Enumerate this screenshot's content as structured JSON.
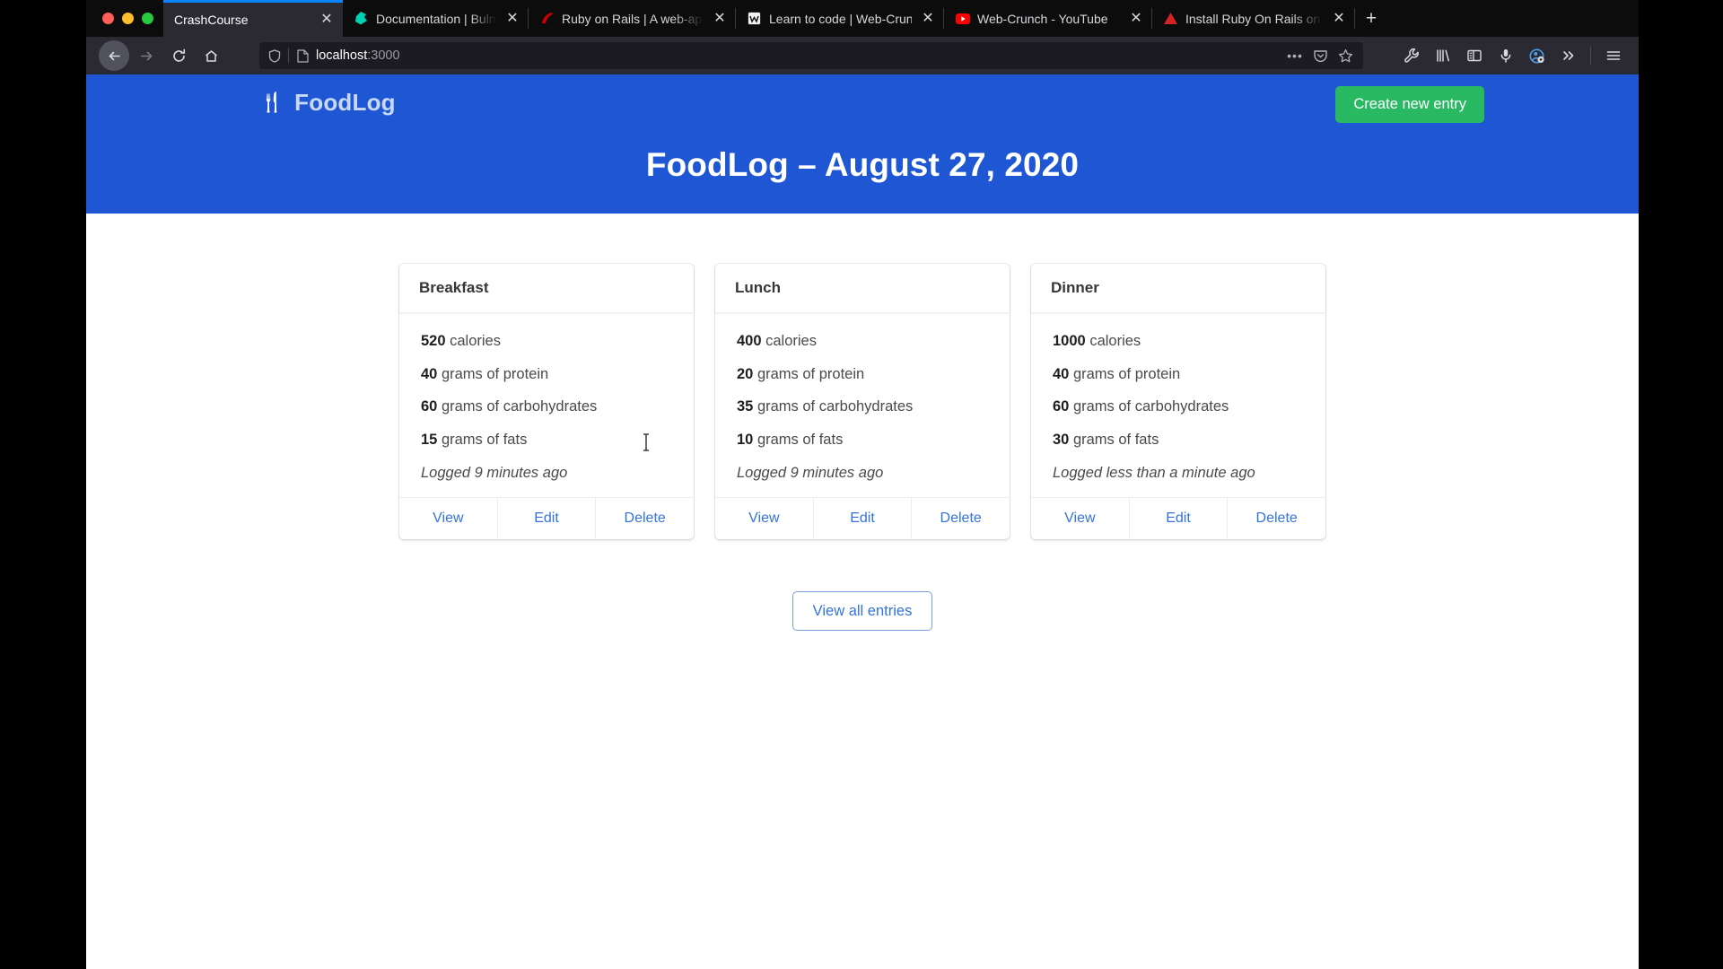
{
  "browser": {
    "traffic_lights": [
      "close",
      "minimize",
      "maximize"
    ],
    "tabs": [
      {
        "title": "CrashCourse",
        "favicon": "",
        "active": true,
        "close_label": "✕"
      },
      {
        "title": "Documentation | Bulma: Free, o",
        "favicon": "bulma-icon",
        "active": false,
        "close_label": "✕"
      },
      {
        "title": "Ruby on Rails | A web-applicat",
        "favicon": "rails-icon",
        "active": false,
        "close_label": "✕"
      },
      {
        "title": "Learn to code | Web-Crunch",
        "favicon": "webcrunch-icon",
        "active": false,
        "close_label": "✕"
      },
      {
        "title": "Web-Crunch - YouTube",
        "favicon": "youtube-icon",
        "active": false,
        "close_label": "✕"
      },
      {
        "title": "Install Ruby On Rails on macOS",
        "favicon": "medium-icon",
        "active": false,
        "close_label": "✕"
      }
    ],
    "new_tab_label": "+",
    "nav": {
      "back_label": "←",
      "forward_label": "→",
      "reload_label": "↻",
      "home_label": "⌂"
    },
    "url_bar": {
      "host": "localhost",
      "port": ":3000",
      "shield_icon": "shield-icon",
      "page_icon": "page-icon",
      "more_icon": "•••",
      "pocket_icon": "pocket-icon",
      "bookmark_icon": "star-icon"
    },
    "toolbar_icons": [
      "wrench-icon",
      "library-icon",
      "sidebar-icon",
      "pocket-save-icon",
      "container-account-icon",
      "overflow-chevrons-icon",
      "hamburger-menu-icon"
    ]
  },
  "page": {
    "brand": {
      "icon": "🍴",
      "name": "FoodLog"
    },
    "create_entry_label": "Create new entry",
    "title": "FoodLog – August 27, 2020",
    "view_all_label": "View all entries",
    "cards": [
      {
        "name": "Breakfast",
        "calories_value": "520",
        "calories_label": "calories",
        "protein_value": "40",
        "protein_label": "grams of protein",
        "carbs_value": "60",
        "carbs_label": "grams of carbohydrates",
        "fats_value": "15",
        "fats_label": "grams of fats",
        "logged": "Logged 9 minutes ago",
        "actions": {
          "view": "View",
          "edit": "Edit",
          "delete": "Delete"
        }
      },
      {
        "name": "Lunch",
        "calories_value": "400",
        "calories_label": "calories",
        "protein_value": "20",
        "protein_label": "grams of protein",
        "carbs_value": "35",
        "carbs_label": "grams of carbohydrates",
        "fats_value": "10",
        "fats_label": "grams of fats",
        "logged": "Logged 9 minutes ago",
        "actions": {
          "view": "View",
          "edit": "Edit",
          "delete": "Delete"
        }
      },
      {
        "name": "Dinner",
        "calories_value": "1000",
        "calories_label": "calories",
        "protein_value": "40",
        "protein_label": "grams of protein",
        "carbs_value": "60",
        "carbs_label": "grams of carbohydrates",
        "fats_value": "30",
        "fats_label": "grams of fats",
        "logged": "Logged less than a minute ago",
        "actions": {
          "view": "View",
          "edit": "Edit",
          "delete": "Delete"
        }
      }
    ]
  },
  "colors": {
    "hero_blue": "#1f56d3",
    "create_button_green": "#2ab963",
    "link_blue": "#3273dc",
    "active_tab_accent": "#0a84ff",
    "chrome_dark": "#2b2a33"
  }
}
